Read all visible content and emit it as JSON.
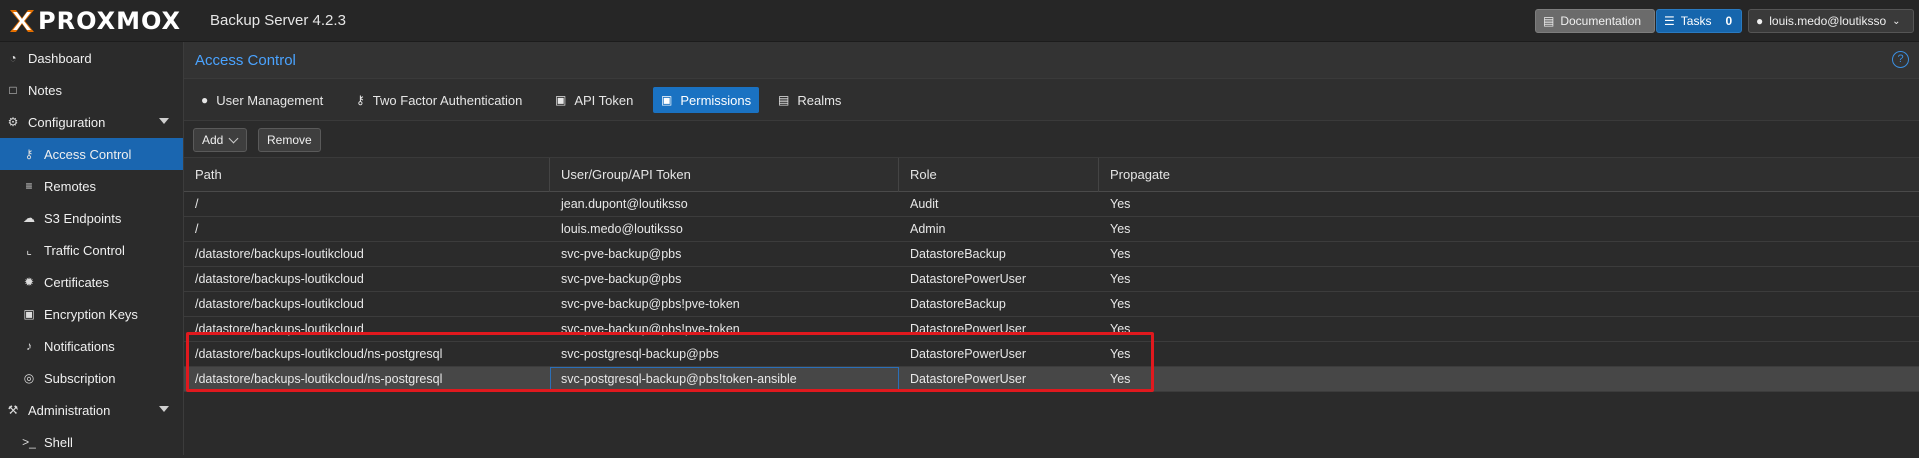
{
  "topbar": {
    "logo_text": "PROXMOX",
    "product": "Backup Server 4.2.3",
    "documentation_label": "Documentation",
    "tasks_label": "Tasks",
    "tasks_count": "0",
    "user_label": "louis.medo@loutiksso"
  },
  "sidebar": {
    "items": [
      {
        "label": "Dashboard",
        "icon": "dashboard-icon"
      },
      {
        "label": "Notes",
        "icon": "notes-icon"
      },
      {
        "label": "Configuration",
        "icon": "gears-icon"
      },
      {
        "label": "Access Control",
        "icon": "key-icon"
      },
      {
        "label": "Remotes",
        "icon": "server-icon"
      },
      {
        "label": "S3 Endpoints",
        "icon": "cloud-upload-icon"
      },
      {
        "label": "Traffic Control",
        "icon": "traffic-control-icon"
      },
      {
        "label": "Certificates",
        "icon": "certificate-icon"
      },
      {
        "label": "Encryption Keys",
        "icon": "lock-icon"
      },
      {
        "label": "Notifications",
        "icon": "bell-icon"
      },
      {
        "label": "Subscription",
        "icon": "support-icon"
      },
      {
        "label": "Administration",
        "icon": "wrench-icon"
      },
      {
        "label": "Shell",
        "icon": "terminal-icon"
      }
    ]
  },
  "panel": {
    "title": "Access Control",
    "help": "?"
  },
  "tabs": [
    {
      "label": "User Management",
      "icon": "user-icon"
    },
    {
      "label": "Two Factor Authentication",
      "icon": "key-icon"
    },
    {
      "label": "API Token",
      "icon": "lock-icon"
    },
    {
      "label": "Permissions",
      "icon": "unlock-icon"
    },
    {
      "label": "Realms",
      "icon": "address-book-icon"
    }
  ],
  "toolbar": {
    "add_label": "Add",
    "remove_label": "Remove"
  },
  "grid": {
    "columns": [
      "Path",
      "User/Group/API Token",
      "Role",
      "Propagate"
    ],
    "rows": [
      [
        "/",
        "jean.dupont@loutiksso",
        "Audit",
        "Yes"
      ],
      [
        "/",
        "louis.medo@loutiksso",
        "Admin",
        "Yes"
      ],
      [
        "/datastore/backups-loutikcloud",
        "svc-pve-backup@pbs",
        "DatastoreBackup",
        "Yes"
      ],
      [
        "/datastore/backups-loutikcloud",
        "svc-pve-backup@pbs",
        "DatastorePowerUser",
        "Yes"
      ],
      [
        "/datastore/backups-loutikcloud",
        "svc-pve-backup@pbs!pve-token",
        "DatastoreBackup",
        "Yes"
      ],
      [
        "/datastore/backups-loutikcloud",
        "svc-pve-backup@pbs!pve-token",
        "DatastorePowerUser",
        "Yes"
      ],
      [
        "/datastore/backups-loutikcloud/ns-postgresql",
        "svc-postgresql-backup@pbs",
        "DatastorePowerUser",
        "Yes"
      ],
      [
        "/datastore/backups-loutikcloud/ns-postgresql",
        "svc-postgresql-backup@pbs!token-ansible",
        "DatastorePowerUser",
        "Yes"
      ]
    ]
  },
  "colors": {
    "accent": "#1a72c2",
    "title_text": "#4aa3ff",
    "highlight": "#e0191e"
  }
}
